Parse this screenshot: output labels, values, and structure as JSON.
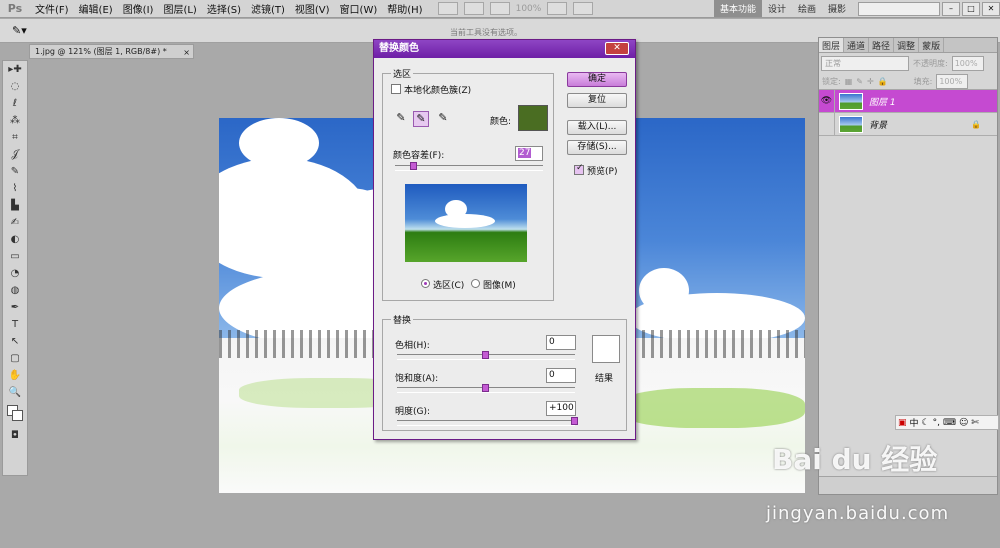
{
  "app": {
    "logo": "Ps",
    "menu": [
      "文件(F)",
      "编辑(E)",
      "图像(I)",
      "图层(L)",
      "选择(S)",
      "滤镜(T)",
      "视图(V)",
      "窗口(W)",
      "帮助(H)"
    ],
    "zoom": "100%",
    "workspaces": [
      "基本功能",
      "设计",
      "绘画",
      "摄影"
    ],
    "options_hint": "当前工具没有选项。"
  },
  "document": {
    "tab_title": "1.jpg @ 121% (图层 1, RGB/8#) *",
    "close": "×"
  },
  "tools": [
    "▸✚",
    "◌",
    "ℓ",
    "⁂",
    "⌗",
    "𝒥",
    "✎",
    "⌇",
    "▙",
    "✍",
    "◐",
    "▭",
    "◔",
    "◍",
    "✒",
    "T",
    "↖",
    "▢",
    "✋",
    "🔍"
  ],
  "dialog": {
    "title": "替换颜色",
    "close": "✕",
    "selection_group": "选区",
    "localized_label": "本地化颜色簇(Z)",
    "color_label": "颜色:",
    "color_value": "#4a6d22",
    "fuzziness_label": "颜色容差(F):",
    "fuzziness_value": "27",
    "fuzziness_pct": 13,
    "radio_selection": "选区(C)",
    "radio_image": "图像(M)",
    "replace_group": "替换",
    "hue_label": "色相(H):",
    "hue_value": "0",
    "hue_pct": 50,
    "sat_label": "饱和度(A):",
    "sat_value": "0",
    "sat_pct": 50,
    "light_label": "明度(G):",
    "light_value": "+100",
    "light_pct": 100,
    "result_label": "结果",
    "ok": "确定",
    "reset": "复位",
    "load": "载入(L)...",
    "save": "存储(S)...",
    "preview_label": "预览(P)",
    "preview_checked": true
  },
  "layers_panel": {
    "tabs": [
      "图层",
      "通道",
      "路径",
      "调整",
      "蒙版"
    ],
    "blend_mode": "正常",
    "opacity_label": "不透明度:",
    "opacity_value": "100%",
    "lock_label": "锁定:",
    "fill_label": "填充:",
    "fill_value": "100%",
    "layers": [
      {
        "name": "图层 1",
        "selected": true,
        "locked": false
      },
      {
        "name": "背景",
        "selected": false,
        "locked": true
      }
    ]
  },
  "ime": {
    "label": "中"
  },
  "watermark": {
    "brand": "Bai du 经验",
    "url": "jingyan.baidu.com"
  }
}
